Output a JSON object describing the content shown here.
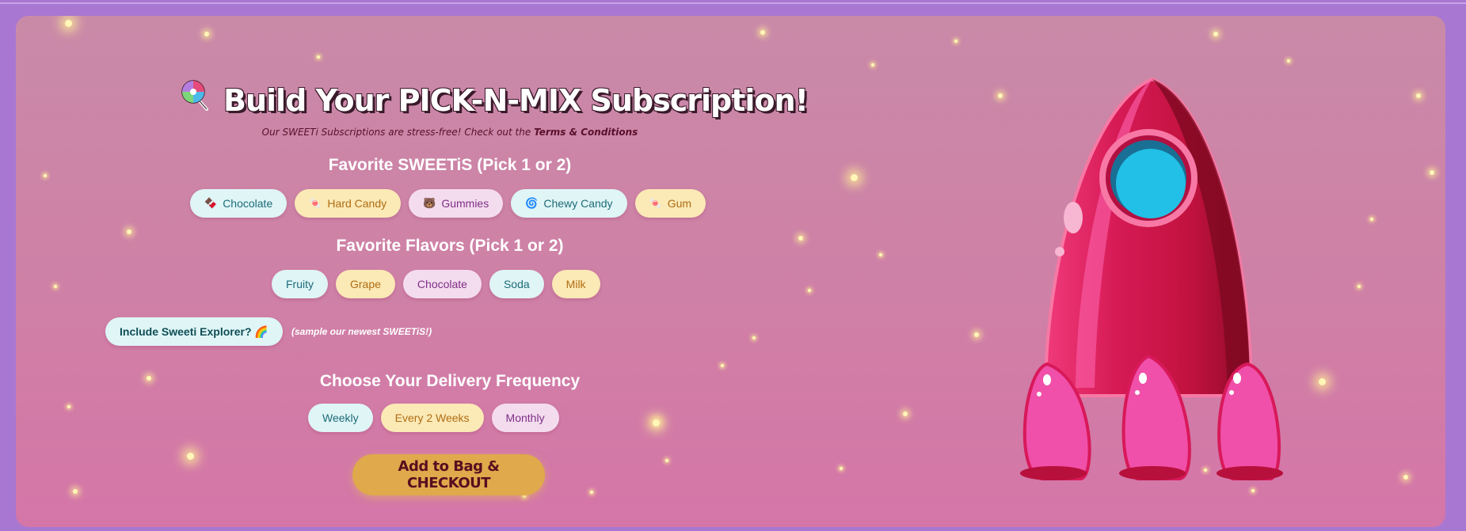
{
  "header": {
    "title": "Build Your PICK-N-MIX Subscription!",
    "title_icon": "lollipop-icon",
    "subtitle_prefix": "Our SWEETi Subscriptions are stress-free! Check out the ",
    "subtitle_link": "Terms & Conditions"
  },
  "sweetis": {
    "heading": "Favorite SWEETiS (Pick 1 or 2)",
    "options": [
      {
        "label": "Chocolate",
        "icon": "🍫"
      },
      {
        "label": "Hard Candy",
        "icon": "🍬"
      },
      {
        "label": "Gummies",
        "icon": "🐻"
      },
      {
        "label": "Chewy Candy",
        "icon": "🌀"
      },
      {
        "label": "Gum",
        "icon": "🍬"
      }
    ]
  },
  "flavors": {
    "heading": "Favorite Flavors (Pick 1 or 2)",
    "options": [
      "Fruity",
      "Grape",
      "Chocolate",
      "Soda",
      "Milk"
    ]
  },
  "explorer": {
    "label": "Include Sweeti Explorer? 🌈",
    "note": "(sample our newest SWEETiS!)"
  },
  "delivery": {
    "heading": "Choose Your Delivery Frequency",
    "options": [
      "Weekly",
      "Every 2 Weeks",
      "Monthly"
    ]
  },
  "checkout": {
    "label": "Add to Bag & CHECKOUT"
  },
  "colors": {
    "page_background": "#a877d2",
    "chip_blue": "#dff5f6",
    "chip_yellow": "#fbe9b6",
    "chip_pink": "#f4dcef",
    "checkout_button": "#dfa94c",
    "rocket_body": "#c8123f"
  }
}
